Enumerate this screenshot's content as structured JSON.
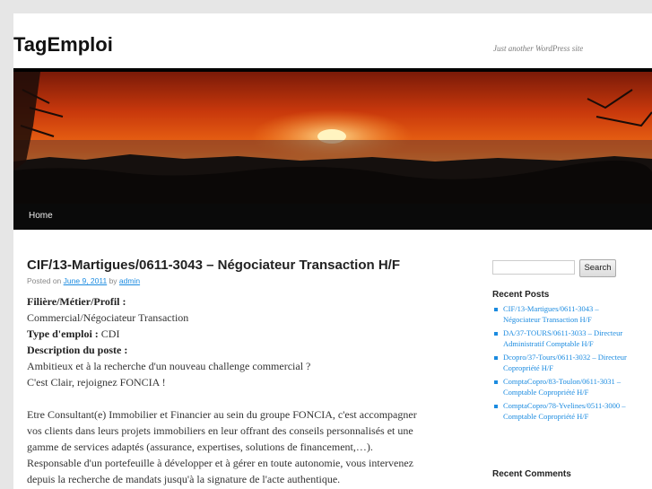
{
  "site": {
    "title": "TagEmploi",
    "tagline": "Just another WordPress site"
  },
  "nav": {
    "items": [
      {
        "label": "Home"
      }
    ]
  },
  "post": {
    "title": "CIF/13-Martigues/0611-3043 – Négociateur Transaction H/F",
    "meta": {
      "posted_on": "Posted on",
      "date": "June 9, 2011",
      "by": "by",
      "author": "admin"
    },
    "filiere_label": "Filière/Métier/Profil :",
    "filiere_value": "Commercial/Négociateur Transaction",
    "type_label": "Type d'emploi :",
    "type_value": "CDI",
    "desc_label": "Description du poste :",
    "lines": [
      "Ambitieux et à la recherche d'un nouveau challenge commercial ?",
      "C'est Clair, rejoignez FONCIA !",
      "Etre Consultant(e) Immobilier et Financier au sein du groupe FONCIA, c'est accompagner",
      "vos clients dans leurs projets immobiliers en leur offrant des conseils personnalisés et une",
      "gamme de services adaptés (assurance, expertises, solutions de financement,…).",
      "Responsable d'un portefeuille à développer et à gérer en toute autonomie, vous intervenez",
      "depuis la recherche de mandats jusqu'à la signature de l'acte authentique."
    ]
  },
  "sidebar": {
    "search": {
      "placeholder": "",
      "button": "Search"
    },
    "recent_posts_title": "Recent Posts",
    "recent_posts": [
      "CIF/13-Martigues/0611-3043 – Négociateur Transaction H/F",
      "DA/37-TOURS/0611-3033 – Directeur Administratif Comptable H/F",
      "Dcopro/37-Tours/0611-3032 – Directeur Copropriété H/F",
      "ComptaCopro/83-Toulon/0611-3031 – Comptable Copropriété H/F",
      "ComptaCopro/78-Yvelines/0511-3000 – Comptable Copropriété H/F"
    ],
    "recent_comments_title": "Recent Comments"
  },
  "colors": {
    "link": "#1b8be0",
    "nav_bg": "#0a0a0a",
    "page_bg": "#e6e6e6"
  }
}
